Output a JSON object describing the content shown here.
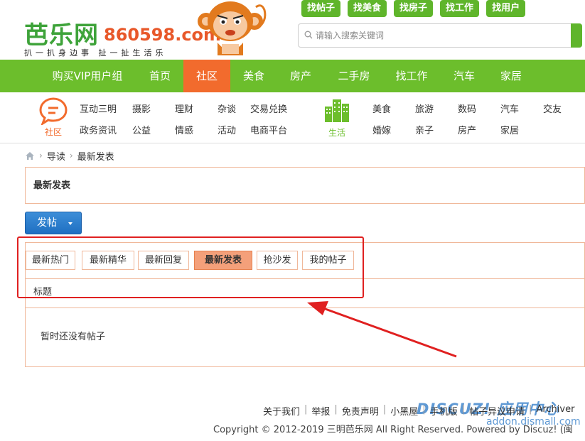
{
  "header": {
    "logo_cn": "芭乐网",
    "logo_domain": "860598.com",
    "slogan": "扒一扒身边事 扯一扯生活乐",
    "quick_links": [
      "找帖子",
      "找美食",
      "找房子",
      "找工作",
      "找用户"
    ],
    "search_placeholder": "请输入搜索关键词"
  },
  "mainnav": {
    "items": [
      "购买VIP用户组",
      "首页",
      "社区",
      "美食",
      "房产",
      "二手房",
      "找工作",
      "汽车",
      "家居"
    ],
    "active": "社区"
  },
  "subnav": {
    "community_label": "社区",
    "community_links": [
      "互动三明",
      "摄影",
      "理财",
      "杂谈",
      "交易兑换",
      "政务资讯",
      "公益",
      "情感",
      "活动",
      "电商平台"
    ],
    "life_label": "生活",
    "life_links": [
      "美食",
      "旅游",
      "数码",
      "汽车",
      "交友",
      "婚嫁",
      "亲子",
      "房产",
      "家居"
    ]
  },
  "breadcrumb": {
    "items": [
      "导读",
      "最新发表"
    ]
  },
  "page_title": "最新发表",
  "post_button": "发帖",
  "tabs": {
    "items": [
      "最新热门",
      "最新精华",
      "最新回复",
      "最新发表",
      "抢沙发",
      "我的帖子"
    ],
    "active": "最新发表"
  },
  "table": {
    "header": "标题",
    "empty_text": "暂时还没有帖子"
  },
  "footer": {
    "links": [
      "关于我们",
      "举报",
      "免责声明",
      "小黑屋",
      "手机版",
      "帖子异议申请",
      "Archiver"
    ],
    "copyright": "Copyright © 2012-2019 三明芭乐网 All Right Reserved. Powered by Discuz! (闽"
  },
  "watermark": {
    "main": "DISCUZ! 应用中心",
    "sub": "addon.dismall.com"
  },
  "colors": {
    "brand_green": "#6cbe2c",
    "active_orange": "#f26b2d",
    "tab_active": "#f4a07a",
    "post_blue": "#1f6fc2",
    "annotation_red": "#e02020"
  }
}
